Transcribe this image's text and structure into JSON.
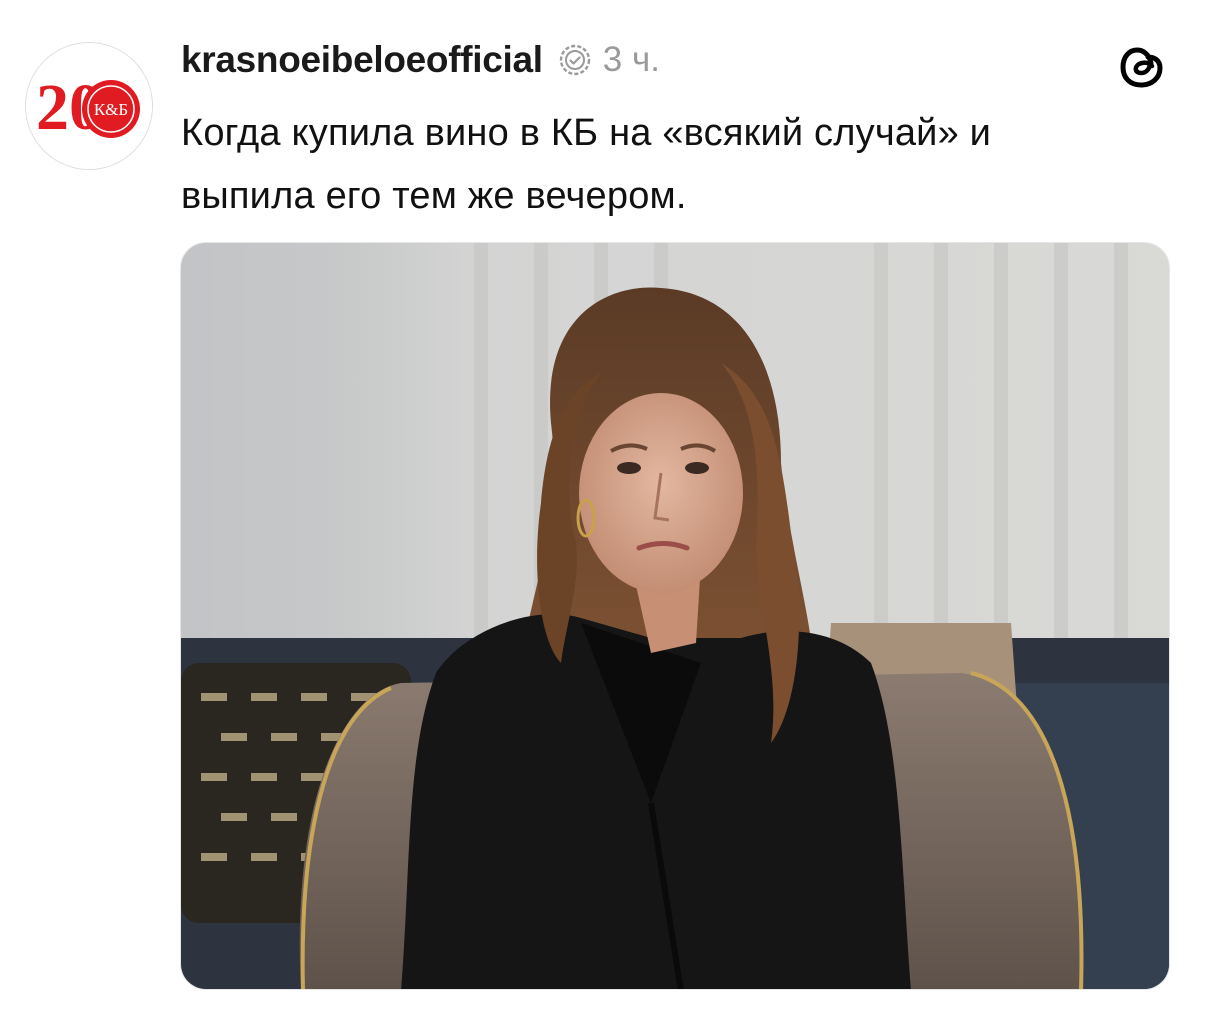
{
  "post": {
    "username": "krasnoeibeloeofficial",
    "time": "3 ч.",
    "text_line1": "Когда купила вино в КБ на «всякий случай» и",
    "text_line2": "выпила его тем же вечером."
  },
  "avatar": {
    "logo_number": "20",
    "logo_text": "К&Б",
    "brand_color": "#e11b22"
  },
  "icons": {
    "verified": "verified-badge-icon",
    "threads": "threads-logo-icon"
  },
  "media": {
    "type": "photo"
  },
  "colors": {
    "username": "#1a1a1a",
    "muted": "#9a9a9a",
    "text": "#111111"
  }
}
